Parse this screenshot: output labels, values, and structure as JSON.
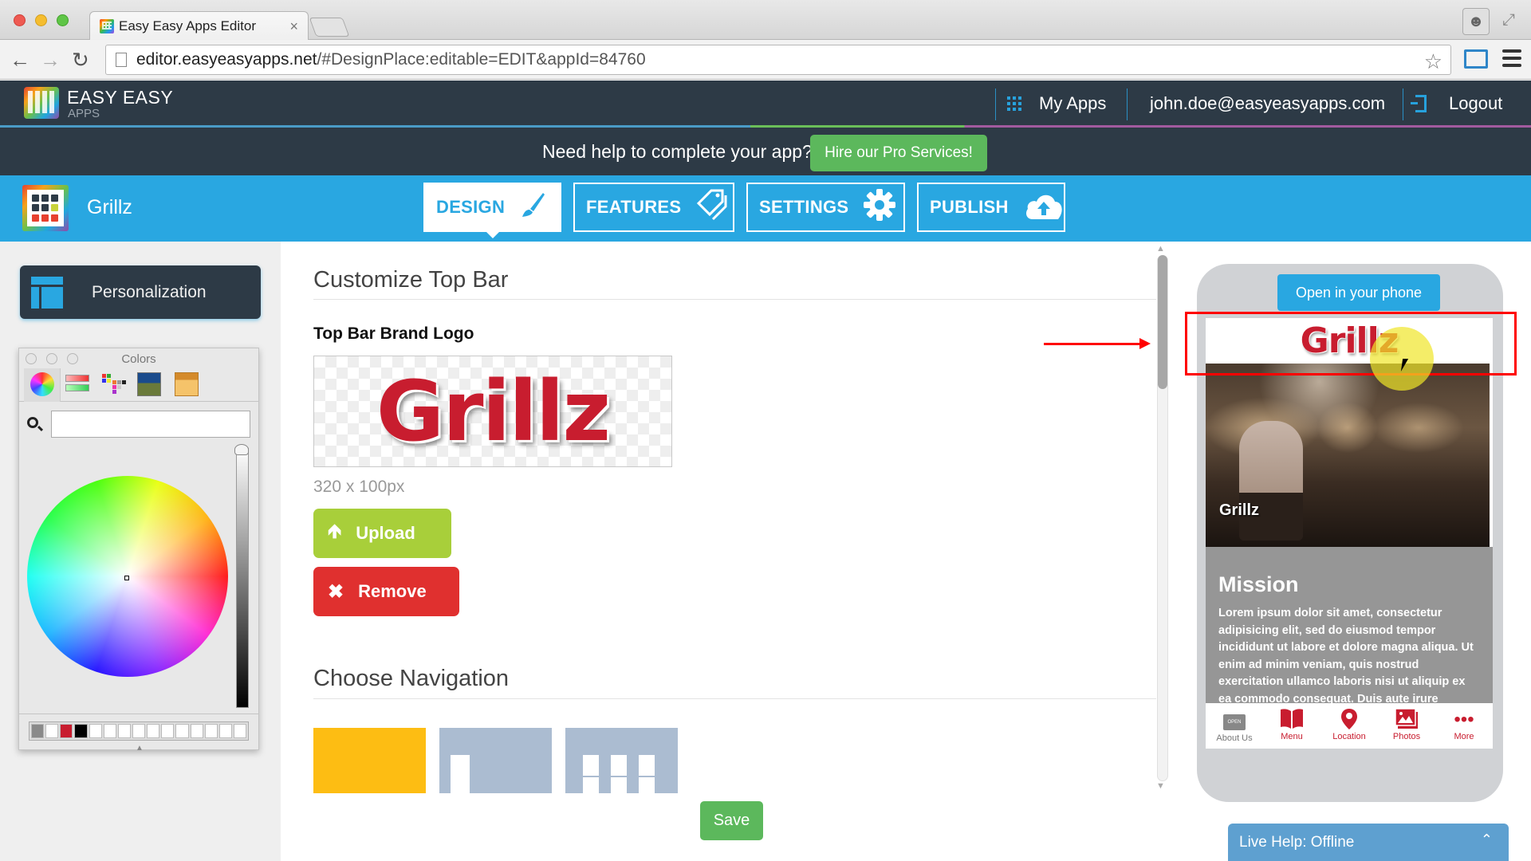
{
  "browser": {
    "tab_title": "Easy Easy Apps Editor",
    "url_host": "editor.easyeasyapps.net",
    "url_path": "/#DesignPlace:editable=EDIT&appId=84760"
  },
  "header": {
    "brand_title": "EASY EASY",
    "brand_sub": "APPS",
    "my_apps": "My Apps",
    "user_email": "john.doe@easyeasyapps.com",
    "logout": "Logout",
    "help_text": "Need help to complete your app?",
    "pro_button": "Hire our Pro Services!"
  },
  "toolbar": {
    "app_name": "Grillz",
    "tabs": [
      {
        "label": "DESIGN",
        "icon": "paintbrush-icon",
        "active": true
      },
      {
        "label": "FEATURES",
        "icon": "tags-icon",
        "active": false
      },
      {
        "label": "SETTINGS",
        "icon": "gear-icon",
        "active": false
      },
      {
        "label": "PUBLISH",
        "icon": "cloud-upload-icon",
        "active": false
      }
    ]
  },
  "sidebar": {
    "personalization_label": "Personalization",
    "colors_panel": {
      "title": "Colors",
      "search_value": "",
      "swatches": [
        "#8a8a8a",
        "#ffffff",
        "#c81d2f",
        "#000000",
        "#ffffff",
        "#ffffff",
        "#ffffff",
        "#ffffff",
        "#ffffff",
        "#ffffff",
        "#ffffff",
        "#ffffff",
        "#ffffff",
        "#ffffff",
        "#ffffff"
      ]
    }
  },
  "main": {
    "section1_title": "Customize Top Bar",
    "logo_label": "Top Bar Brand Logo",
    "logo_text": "Grillz",
    "logo_size_hint": "320 x 100px",
    "upload_label": "Upload",
    "remove_label": "Remove",
    "section2_title": "Choose Navigation",
    "navigation_options": [
      {
        "name": "single",
        "selected": true
      },
      {
        "name": "sidebar",
        "selected": false
      },
      {
        "name": "tabs-grid",
        "selected": false
      }
    ],
    "save_label": "Save"
  },
  "preview": {
    "open_phone_label": "Open in your phone",
    "topbar_logo": "Grillz",
    "hero_caption": "Grillz",
    "mission_title": "Mission",
    "mission_body": "Lorem ipsum dolor sit amet, consectetur adipisicing elit, sed do eiusmod tempor incididunt ut labore et dolore magna aliqua. Ut enim ad minim veniam, quis nostrud exercitation ullamco laboris nisi ut aliquip ex ea commodo consequat. Duis aute irure",
    "tabbar": [
      {
        "label": "About Us",
        "icon": "open-sign-icon",
        "active": false
      },
      {
        "label": "Menu",
        "icon": "book-icon",
        "active": true
      },
      {
        "label": "Location",
        "icon": "map-pin-icon",
        "active": true
      },
      {
        "label": "Photos",
        "icon": "photos-icon",
        "active": true
      },
      {
        "label": "More",
        "icon": "more-dots-icon",
        "active": true
      }
    ],
    "open_sign_text": "OPEN"
  },
  "live_help": {
    "label": "Live Help: Offline"
  },
  "colors": {
    "accent_blue": "#29a7e1",
    "header_dark": "#2d3a46",
    "brand_red": "#c81d2f",
    "green": "#5cb85c",
    "upload_green": "#a8cf3a",
    "remove_red": "#e0302f",
    "nav_selected": "#fdbd13",
    "nav_unselected": "#abbcd1"
  }
}
